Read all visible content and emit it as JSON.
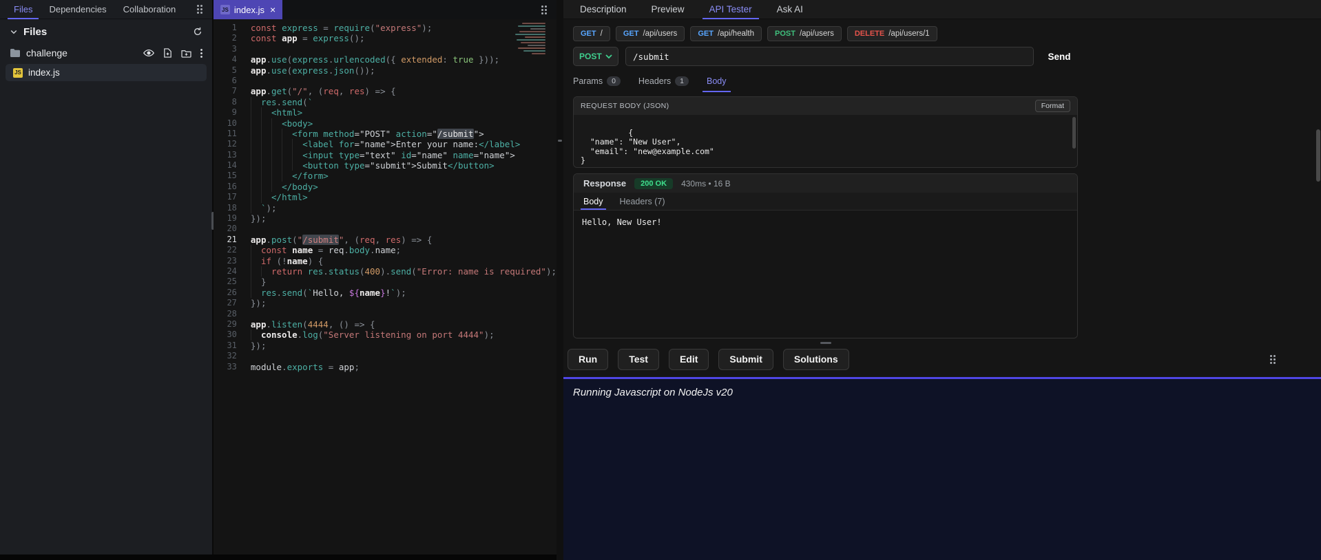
{
  "sidebar": {
    "tabs": [
      {
        "label": "Files",
        "active": true
      },
      {
        "label": "Dependencies",
        "active": false
      },
      {
        "label": "Collaboration",
        "active": false
      }
    ],
    "section": {
      "title": "Files"
    },
    "tree": {
      "folder": "challenge",
      "file": "index.js",
      "file_badge": "JS"
    }
  },
  "editor": {
    "tab": {
      "label": "index.js",
      "badge": "JS",
      "close": "×"
    },
    "active_line": 21,
    "lines": [
      {
        "ind": 0,
        "seg": [
          [
            "k",
            "const"
          ],
          [
            "t",
            " "
          ],
          [
            "f",
            "express"
          ],
          [
            "p",
            " = "
          ],
          [
            "f",
            "require"
          ],
          [
            "p",
            "("
          ],
          [
            "s",
            "\"express\""
          ],
          [
            "p",
            ");"
          ]
        ]
      },
      {
        "ind": 0,
        "seg": [
          [
            "k",
            "const"
          ],
          [
            "t",
            " "
          ],
          [
            "v",
            "app"
          ],
          [
            "p",
            " = "
          ],
          [
            "f",
            "express"
          ],
          [
            "p",
            "();"
          ]
        ]
      },
      {
        "ind": 0,
        "seg": []
      },
      {
        "ind": 0,
        "seg": [
          [
            "v",
            "app"
          ],
          [
            "p",
            "."
          ],
          [
            "f",
            "use"
          ],
          [
            "p",
            "("
          ],
          [
            "f",
            "express"
          ],
          [
            "p",
            "."
          ],
          [
            "f",
            "urlencoded"
          ],
          [
            "p",
            "({ "
          ],
          [
            "n",
            "extended"
          ],
          [
            "p",
            ": "
          ],
          [
            "g",
            "true"
          ],
          [
            "p",
            " }));"
          ]
        ]
      },
      {
        "ind": 0,
        "seg": [
          [
            "v",
            "app"
          ],
          [
            "p",
            "."
          ],
          [
            "f",
            "use"
          ],
          [
            "p",
            "("
          ],
          [
            "f",
            "express"
          ],
          [
            "p",
            "."
          ],
          [
            "f",
            "json"
          ],
          [
            "p",
            "());"
          ]
        ]
      },
      {
        "ind": 0,
        "seg": []
      },
      {
        "ind": 0,
        "seg": [
          [
            "v",
            "app"
          ],
          [
            "p",
            "."
          ],
          [
            "f",
            "get"
          ],
          [
            "p",
            "("
          ],
          [
            "s",
            "\"/\""
          ],
          [
            "p",
            ", ("
          ],
          [
            "k",
            "req"
          ],
          [
            "p",
            ", "
          ],
          [
            "k",
            "res"
          ],
          [
            "p",
            ") => {"
          ]
        ]
      },
      {
        "ind": 2,
        "seg": [
          [
            "f",
            "res"
          ],
          [
            "p",
            "."
          ],
          [
            "f",
            "send"
          ],
          [
            "p",
            "("
          ],
          [
            "f",
            "`"
          ]
        ]
      },
      {
        "ind": 4,
        "seg": [
          [
            "f",
            "<html>"
          ]
        ]
      },
      {
        "ind": 6,
        "seg": [
          [
            "f",
            "<body>"
          ]
        ]
      },
      {
        "ind": 8,
        "seg": [
          [
            "f",
            "<form method"
          ],
          [
            "t",
            "=\"POST\" "
          ],
          [
            "f",
            "action"
          ],
          [
            "t",
            "=\""
          ],
          [
            "hl",
            "/submit"
          ],
          [
            "t",
            "\">"
          ]
        ]
      },
      {
        "ind": 10,
        "seg": [
          [
            "f",
            "<label for"
          ],
          [
            "t",
            "=\"name\">"
          ],
          [
            "t",
            "Enter your name:"
          ],
          [
            "f",
            "</label>"
          ]
        ]
      },
      {
        "ind": 10,
        "seg": [
          [
            "f",
            "<input type"
          ],
          [
            "t",
            "=\"text\" "
          ],
          [
            "f",
            "id"
          ],
          [
            "t",
            "=\"name\" "
          ],
          [
            "f",
            "name"
          ],
          [
            "t",
            "=\"name\">"
          ]
        ]
      },
      {
        "ind": 10,
        "seg": [
          [
            "f",
            "<button type"
          ],
          [
            "t",
            "=\"submit\">"
          ],
          [
            "t",
            "Submit"
          ],
          [
            "f",
            "</button>"
          ]
        ]
      },
      {
        "ind": 8,
        "seg": [
          [
            "f",
            "</form>"
          ]
        ]
      },
      {
        "ind": 6,
        "seg": [
          [
            "f",
            "</body>"
          ]
        ]
      },
      {
        "ind": 4,
        "seg": [
          [
            "f",
            "</html>"
          ]
        ]
      },
      {
        "ind": 2,
        "seg": [
          [
            "f",
            "`"
          ],
          [
            "p",
            ");"
          ]
        ]
      },
      {
        "ind": 0,
        "seg": [
          [
            "p",
            "});"
          ]
        ]
      },
      {
        "ind": 0,
        "seg": []
      },
      {
        "ind": 0,
        "seg": [
          [
            "v",
            "app"
          ],
          [
            "p",
            "."
          ],
          [
            "f",
            "post"
          ],
          [
            "p",
            "("
          ],
          [
            "s",
            "\""
          ],
          [
            "shl",
            "/submit"
          ],
          [
            "s",
            "\""
          ],
          [
            "p",
            ", ("
          ],
          [
            "k",
            "req"
          ],
          [
            "p",
            ", "
          ],
          [
            "k",
            "res"
          ],
          [
            "p",
            ") => {"
          ]
        ]
      },
      {
        "ind": 2,
        "seg": [
          [
            "k",
            "const"
          ],
          [
            "t",
            " "
          ],
          [
            "v",
            "name"
          ],
          [
            "p",
            " = "
          ],
          [
            "t",
            "req"
          ],
          [
            "p",
            "."
          ],
          [
            "f",
            "body"
          ],
          [
            "p",
            "."
          ],
          [
            "t",
            "name"
          ],
          [
            "p",
            ";"
          ]
        ]
      },
      {
        "ind": 2,
        "seg": [
          [
            "k",
            "if"
          ],
          [
            "p",
            " (!"
          ],
          [
            "v",
            "name"
          ],
          [
            "p",
            ") {"
          ]
        ]
      },
      {
        "ind": 4,
        "seg": [
          [
            "k",
            "return"
          ],
          [
            "t",
            " "
          ],
          [
            "f",
            "res"
          ],
          [
            "p",
            "."
          ],
          [
            "f",
            "status"
          ],
          [
            "p",
            "("
          ],
          [
            "n",
            "400"
          ],
          [
            "p",
            ")."
          ],
          [
            "f",
            "send"
          ],
          [
            "p",
            "("
          ],
          [
            "s",
            "\"Error: name is required\""
          ],
          [
            "p",
            ");"
          ]
        ]
      },
      {
        "ind": 2,
        "seg": [
          [
            "p",
            "}"
          ]
        ]
      },
      {
        "ind": 2,
        "seg": [
          [
            "f",
            "res"
          ],
          [
            "p",
            "."
          ],
          [
            "f",
            "send"
          ],
          [
            "p",
            "("
          ],
          [
            "f",
            "`"
          ],
          [
            "t",
            "Hello, "
          ],
          [
            "m",
            "${"
          ],
          [
            "v",
            "name"
          ],
          [
            "m",
            "}"
          ],
          [
            "t",
            "!"
          ],
          [
            "f",
            "`"
          ],
          [
            "p",
            ");"
          ]
        ]
      },
      {
        "ind": 0,
        "seg": [
          [
            "p",
            "});"
          ]
        ]
      },
      {
        "ind": 0,
        "seg": []
      },
      {
        "ind": 0,
        "seg": [
          [
            "v",
            "app"
          ],
          [
            "p",
            "."
          ],
          [
            "f",
            "listen"
          ],
          [
            "p",
            "("
          ],
          [
            "n",
            "4444"
          ],
          [
            "p",
            ", () => {"
          ]
        ]
      },
      {
        "ind": 2,
        "seg": [
          [
            "v",
            "console"
          ],
          [
            "p",
            "."
          ],
          [
            "f",
            "log"
          ],
          [
            "p",
            "("
          ],
          [
            "s",
            "\"Server listening on port 4444\""
          ],
          [
            "p",
            ");"
          ]
        ]
      },
      {
        "ind": 0,
        "seg": [
          [
            "p",
            "});"
          ]
        ]
      },
      {
        "ind": 0,
        "seg": []
      },
      {
        "ind": 0,
        "seg": [
          [
            "t",
            "module"
          ],
          [
            "p",
            "."
          ],
          [
            "f",
            "exports"
          ],
          [
            "p",
            " = "
          ],
          [
            "t",
            "app"
          ],
          [
            "p",
            ";"
          ]
        ]
      }
    ]
  },
  "tester": {
    "tabs": [
      {
        "label": "Description",
        "active": false
      },
      {
        "label": "Preview",
        "active": false
      },
      {
        "label": "API Tester",
        "active": true
      },
      {
        "label": "Ask AI",
        "active": false
      }
    ],
    "endpoints": [
      {
        "method": "GET",
        "path": "/"
      },
      {
        "method": "GET",
        "path": "/api/users"
      },
      {
        "method": "GET",
        "path": "/api/health"
      },
      {
        "method": "POST",
        "path": "/api/users"
      },
      {
        "method": "DELETE",
        "path": "/api/users/1"
      }
    ],
    "request": {
      "method": "POST",
      "url": "/submit",
      "send_label": "Send"
    },
    "request_tabs": [
      {
        "label": "Params",
        "badge": "0",
        "active": false
      },
      {
        "label": "Headers",
        "badge": "1",
        "active": false
      },
      {
        "label": "Body",
        "badge": null,
        "active": true
      }
    ],
    "body_panel": {
      "title": "REQUEST BODY (JSON)",
      "format_label": "Format",
      "json_lines": [
        "{",
        "  \"name\": \"New User\",",
        "  \"email\": \"new@example.com\"",
        "}"
      ]
    },
    "response": {
      "label": "Response",
      "status": "200 OK",
      "meta": "430ms • 16 B",
      "tabs": [
        {
          "label": "Body",
          "active": true
        },
        {
          "label": "Headers (7)",
          "active": false
        }
      ],
      "body": "Hello, New User!"
    }
  },
  "actions": [
    "Run",
    "Test",
    "Edit",
    "Submit",
    "Solutions"
  ],
  "console": {
    "text": "Running Javascript on NodeJs v20"
  },
  "colors": {
    "accent": "#6366f1",
    "GET": "#58a6ff",
    "POST": "#3fbf7c",
    "DELETE": "#e5534b",
    "status_ok": "#3fe08e"
  }
}
